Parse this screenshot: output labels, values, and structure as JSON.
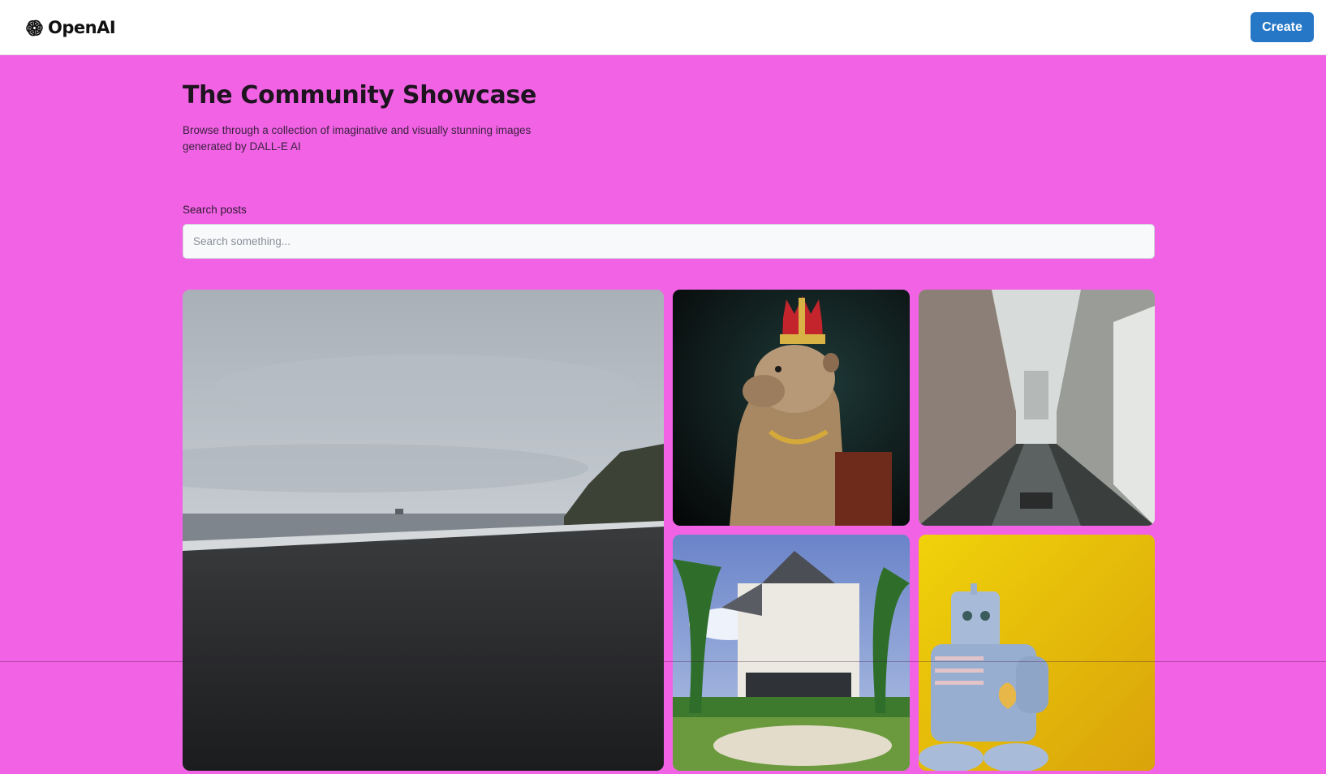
{
  "header": {
    "brand_name": "OpenAI",
    "logo_icon": "openai-logo-icon",
    "create_label": "Create",
    "create_color": "#2678c6"
  },
  "hero": {
    "title": "The Community Showcase",
    "subtitle": "Browse through a collection of imaginative and visually stunning images generated by DALL-E AI"
  },
  "search": {
    "label": "Search posts",
    "placeholder": "Search something...",
    "value": ""
  },
  "theme": {
    "page_background": "#f262e4"
  },
  "gallery": {
    "images": [
      {
        "subject": "black-sand-beach"
      },
      {
        "subject": "crowned-capybara"
      },
      {
        "subject": "wet-narrow-alley"
      },
      {
        "subject": "white-house-with-palms"
      },
      {
        "subject": "blue-toy-robot-on-yellow"
      }
    ]
  }
}
